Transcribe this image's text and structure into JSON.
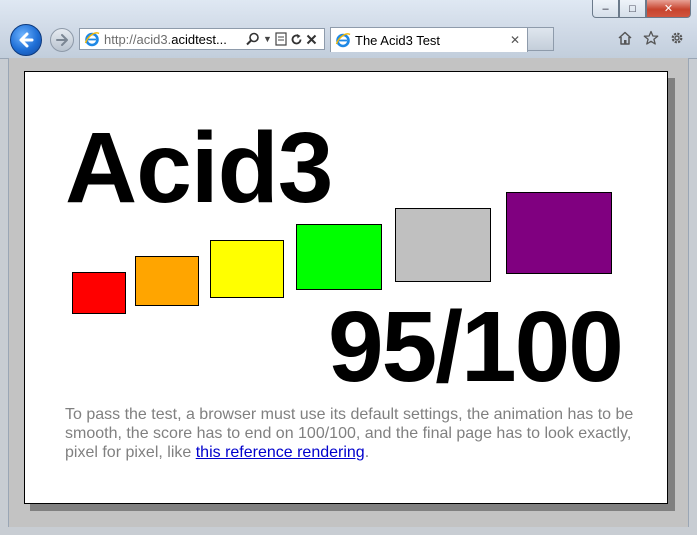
{
  "browser": {
    "address_prefix": "http://acid3.",
    "address_domain": "acidtest...",
    "tab_title": "The Acid3 Test",
    "window_controls": {
      "minimize_icon": "minimize-icon",
      "maximize_icon": "maximize-icon",
      "close_icon": "close-icon"
    },
    "toolbar_icons": [
      "home-icon",
      "favorites-star-icon",
      "settings-gear-icon"
    ]
  },
  "page": {
    "title": "Acid3",
    "score": "95/100",
    "instructions_text": "To pass the test, a browser must use its default settings, the animation has to be smooth, the score has to end on 100/100, and the final page has to look exactly, pixel for pixel, like ",
    "link_text": "this reference rendering",
    "instructions_end": ".",
    "buckets": [
      {
        "name": "bucket-1",
        "color": "#ff0000"
      },
      {
        "name": "bucket-2",
        "color": "#ffa500"
      },
      {
        "name": "bucket-3",
        "color": "#ffff00"
      },
      {
        "name": "bucket-4",
        "color": "#00ff00"
      },
      {
        "name": "bucket-5",
        "color": "#c0c0c0"
      },
      {
        "name": "bucket-6",
        "color": "#800080"
      }
    ]
  },
  "colors": {
    "page_background": "#ffffff",
    "viewport_background": "#c3c3c3",
    "text_gray": "#808080",
    "link_blue": "#0000cc"
  }
}
